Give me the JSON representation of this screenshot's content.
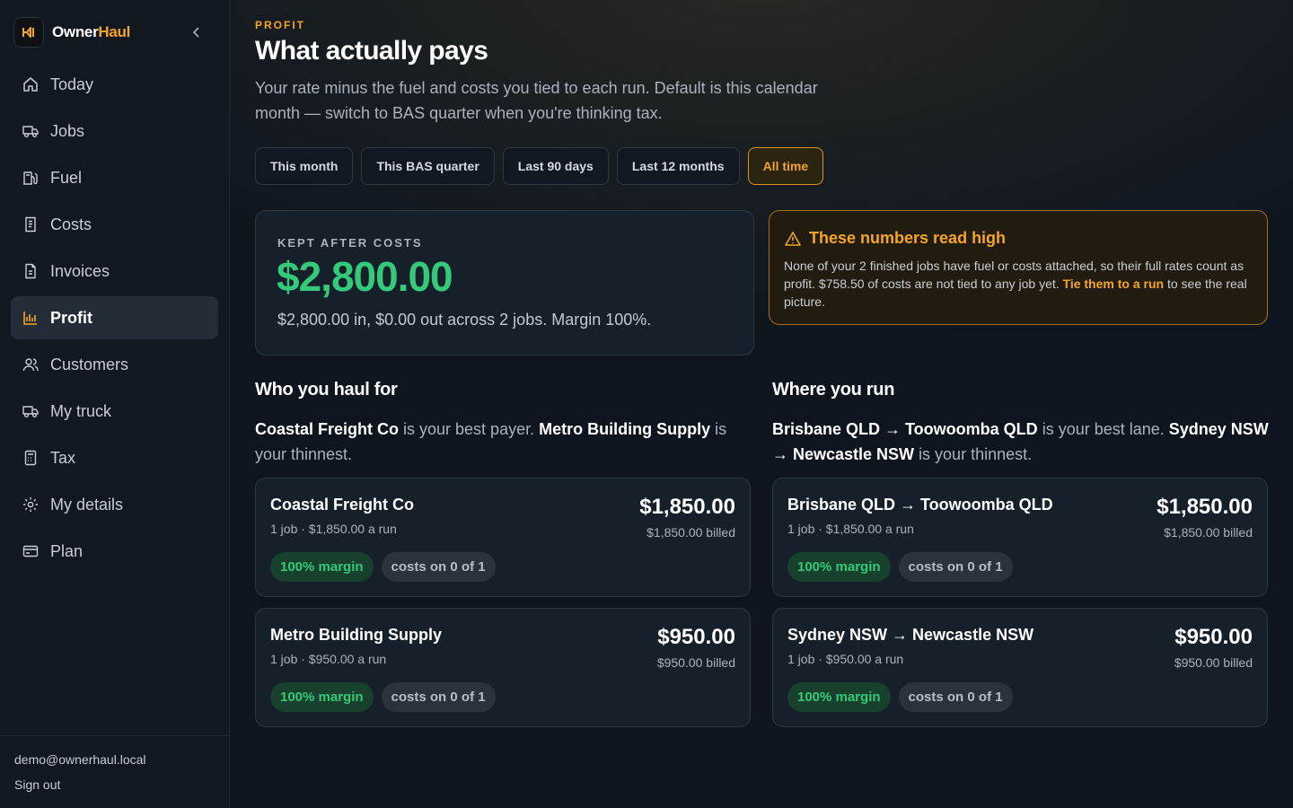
{
  "brand": {
    "name_main": "Owner",
    "name_accent": "Haul",
    "accent_color": "#f5a524"
  },
  "sidebar": {
    "collapse_icon": "chevron-left-icon",
    "items": [
      {
        "label": "Today",
        "icon": "home-icon"
      },
      {
        "label": "Jobs",
        "icon": "truck-icon"
      },
      {
        "label": "Fuel",
        "icon": "fuel-pump-icon"
      },
      {
        "label": "Costs",
        "icon": "receipt-icon"
      },
      {
        "label": "Invoices",
        "icon": "document-icon"
      },
      {
        "label": "Profit",
        "icon": "bar-chart-icon",
        "active": true
      },
      {
        "label": "Customers",
        "icon": "users-icon"
      },
      {
        "label": "My truck",
        "icon": "truck-icon"
      },
      {
        "label": "Tax",
        "icon": "calculator-icon"
      },
      {
        "label": "My details",
        "icon": "gear-icon"
      },
      {
        "label": "Plan",
        "icon": "credit-card-icon"
      }
    ],
    "footer": {
      "email": "demo@ownerhaul.local",
      "sign_out": "Sign out"
    }
  },
  "header": {
    "eyebrow": "PROFIT",
    "title": "What actually pays",
    "subtitle": "Your rate minus the fuel and costs you tied to each run. Default is this calendar month — switch to BAS quarter when you're thinking tax."
  },
  "filters": [
    {
      "label": "This month"
    },
    {
      "label": "This BAS quarter"
    },
    {
      "label": "Last 90 days"
    },
    {
      "label": "Last 12 months"
    },
    {
      "label": "All time",
      "active": true
    }
  ],
  "summary": {
    "label": "KEPT AFTER COSTS",
    "value": "$2,800.00",
    "detail": "$2,800.00 in, $0.00 out across 2 jobs. Margin 100%.",
    "value_color": "#35c97a"
  },
  "warning": {
    "icon": "warning-triangle-icon",
    "title": "These numbers read high",
    "body_before": "None of your 2 finished jobs have fuel or costs attached, so their full rates count as profit. $758.50 of costs are not tied to any job yet. ",
    "link": "Tie them to a run",
    "body_after": " to see the real picture."
  },
  "customers": {
    "title": "Who you haul for",
    "best": "Coastal Freight Co",
    "best_suffix": " is your best payer. ",
    "thinnest": "Metro Building Supply",
    "thinnest_suffix": " is your thinnest.",
    "rows": [
      {
        "name": "Coastal Freight Co",
        "meta": "1 job · $1,850.00 a run",
        "amount": "$1,850.00",
        "billed": "$1,850.00 billed",
        "margin": "100% margin",
        "costs": "costs on 0 of 1"
      },
      {
        "name": "Metro Building Supply",
        "meta": "1 job · $950.00 a run",
        "amount": "$950.00",
        "billed": "$950.00 billed",
        "margin": "100% margin",
        "costs": "costs on 0 of 1"
      }
    ]
  },
  "lanes": {
    "title": "Where you run",
    "best": "Brisbane QLD → Toowoomba QLD",
    "best_suffix": " is your best lane. ",
    "thinnest": "Sydney NSW → Newcastle NSW",
    "thinnest_suffix": " is your thinnest.",
    "rows": [
      {
        "name": "Brisbane QLD → Toowoomba QLD",
        "meta": "1 job · $1,850.00 a run",
        "amount": "$1,850.00",
        "billed": "$1,850.00 billed",
        "margin": "100% margin",
        "costs": "costs on 0 of 1"
      },
      {
        "name": "Sydney NSW → Newcastle NSW",
        "meta": "1 job · $950.00 a run",
        "amount": "$950.00",
        "billed": "$950.00 billed",
        "margin": "100% margin",
        "costs": "costs on 0 of 1"
      }
    ]
  }
}
